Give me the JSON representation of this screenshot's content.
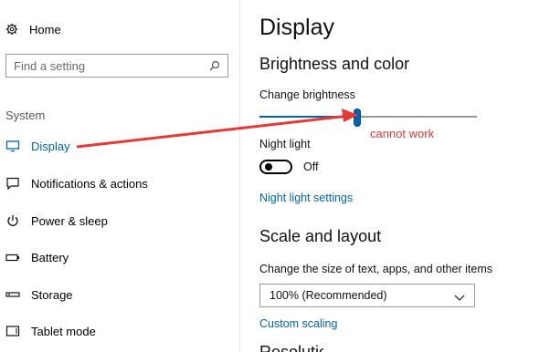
{
  "sidebar": {
    "home_label": "Home",
    "search_placeholder": "Find a setting",
    "section_label": "System",
    "items": [
      {
        "label": "Display",
        "icon": "monitor-icon",
        "active": true
      },
      {
        "label": "Notifications & actions",
        "icon": "notification-icon"
      },
      {
        "label": "Power & sleep",
        "icon": "power-icon"
      },
      {
        "label": "Battery",
        "icon": "battery-icon"
      },
      {
        "label": "Storage",
        "icon": "storage-icon"
      },
      {
        "label": "Tablet mode",
        "icon": "tablet-icon"
      }
    ]
  },
  "main": {
    "page_title": "Display",
    "brightness_section_title": "Brightness and color",
    "change_brightness_label": "Change brightness",
    "brightness_value_percent": 45,
    "night_light_label": "Night light",
    "night_light_state": "Off",
    "night_light_settings_link": "Night light settings",
    "scale_section_title": "Scale and layout",
    "scale_label": "Change the size of text, apps, and other items",
    "scale_selected": "100% (Recommended)",
    "custom_scaling_link": "Custom scaling",
    "next_section_title_partial": "Resolution"
  },
  "annotation": {
    "text": "cannot work",
    "color": "#e53935"
  },
  "colors": {
    "accent": "#0063b1"
  }
}
